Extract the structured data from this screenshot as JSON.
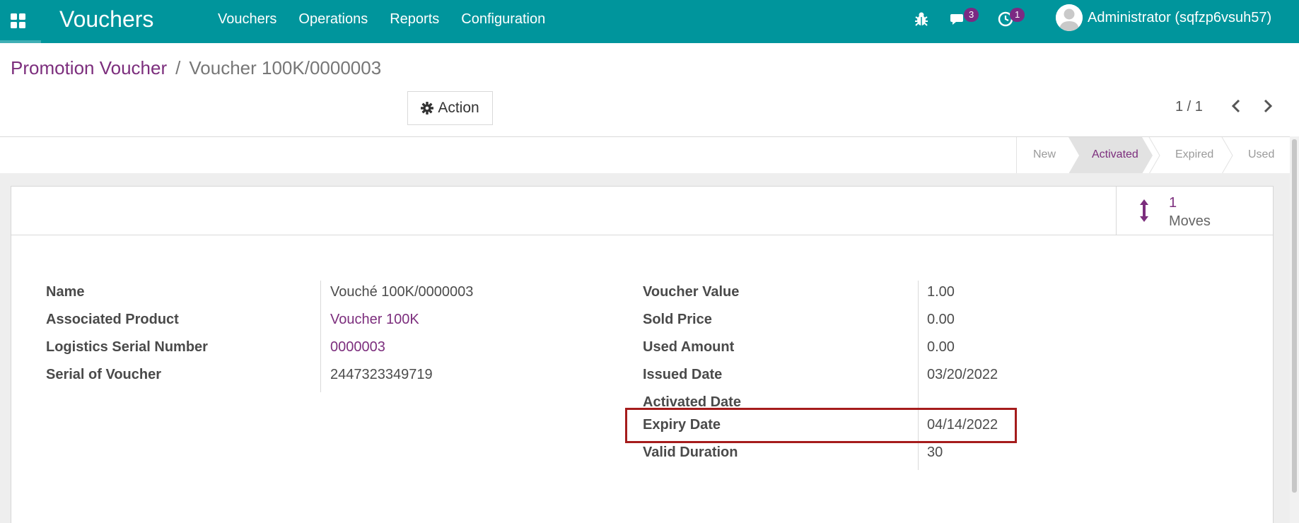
{
  "topbar": {
    "app_name": "Vouchers",
    "menu": [
      "Vouchers",
      "Operations",
      "Reports",
      "Configuration"
    ],
    "messages_count": "3",
    "activities_count": "1",
    "user_name": "Administrator (sqfzp6vsuh57)",
    "color": "#00959c"
  },
  "breadcrumb": {
    "parent": "Promotion Voucher",
    "separator": "/",
    "current": "Voucher 100K/0000003"
  },
  "toolbar": {
    "action_label": "Action",
    "pager": "1 / 1"
  },
  "statusbar": {
    "stages": [
      "New",
      "Activated",
      "Expired",
      "Used"
    ],
    "active_stage": "Activated"
  },
  "smart_buttons": {
    "moves_count": "1",
    "moves_label": "Moves"
  },
  "fields_left": [
    {
      "label": "Name",
      "value": "Vouché 100K/0000003"
    },
    {
      "label": "Associated Product",
      "value": "Voucher 100K"
    },
    {
      "label": "Logistics Serial Number",
      "value": "0000003"
    },
    {
      "label": "Serial of Voucher",
      "value": "2447323349719"
    }
  ],
  "fields_right": [
    {
      "label": "Voucher Value",
      "value": "1.00"
    },
    {
      "label": "Sold Price",
      "value": "0.00"
    },
    {
      "label": "Used Amount",
      "value": "0.00"
    },
    {
      "label": "Issued Date",
      "value": "03/20/2022"
    },
    {
      "label": "Activated Date",
      "value": ""
    },
    {
      "label": "Expiry Date",
      "value": "04/14/2022"
    },
    {
      "label": "Valid Duration",
      "value": "30"
    }
  ],
  "colors": {
    "link": "#7c2e7d",
    "highlight": "#a51c1c"
  }
}
